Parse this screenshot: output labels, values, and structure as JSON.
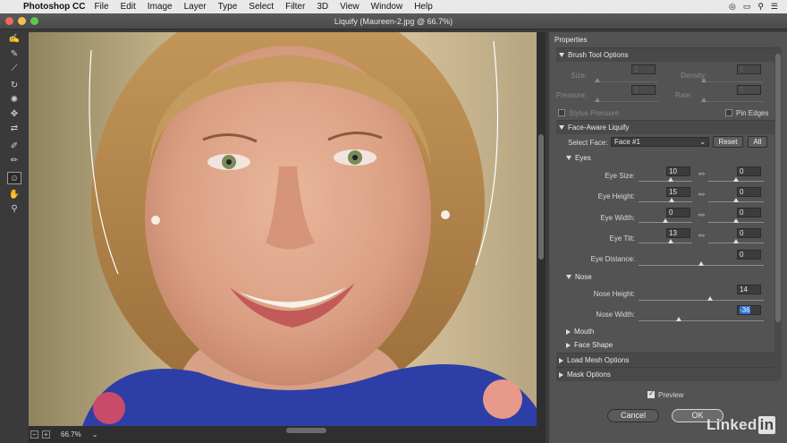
{
  "menubar": {
    "app": "Photoshop CC",
    "items": [
      "File",
      "Edit",
      "Image",
      "Layer",
      "Type",
      "Select",
      "Filter",
      "3D",
      "View",
      "Window",
      "Help"
    ]
  },
  "window": {
    "title": "Liquify (Maureen-2.jpg @ 66.7%)"
  },
  "status": {
    "zoom": "66.7%"
  },
  "panel": {
    "title": "Properties",
    "brush": {
      "header": "Brush Tool Options",
      "size": "Size:",
      "density": "Density:",
      "pressure": "Pressure:",
      "rate": "Rate:",
      "stylus": "Stylus Pressure",
      "pin_edges": "Pin Edges",
      "size_val": "1",
      "density_val": "0",
      "pressure_val": "1",
      "rate_val": "0"
    },
    "face": {
      "header": "Face-Aware Liquify",
      "select_face": "Select Face:",
      "face_value": "Face #1",
      "reset": "Reset",
      "all": "All",
      "eyes": {
        "header": "Eyes",
        "size": "Eye Size:",
        "height": "Eye Height:",
        "width": "Eye Width:",
        "tilt": "Eye Tilt:",
        "distance": "Eye Distance:",
        "size_l": "10",
        "size_r": "0",
        "height_l": "15",
        "height_r": "0",
        "width_l": "0",
        "width_r": "0",
        "tilt_l": "13",
        "tilt_r": "0",
        "distance_val": "0",
        "levels": {
          "size_l": 0.6,
          "size_r": 0.5,
          "height_l": 0.62,
          "height_r": 0.5,
          "width_l": 0.5,
          "width_r": 0.5,
          "tilt_l": 0.6,
          "tilt_r": 0.5,
          "distance": 0.5
        }
      },
      "nose": {
        "header": "Nose",
        "height": "Nose Height:",
        "width": "Nose Width:",
        "height_val": "14",
        "width_val": "-36",
        "height_level": 0.57,
        "width_level": 0.32
      },
      "mouth": "Mouth",
      "face_shape": "Face Shape"
    },
    "load_mesh": "Load Mesh Options",
    "mask": "Mask Options",
    "preview": "Preview",
    "cancel": "Cancel",
    "ok": "OK"
  },
  "watermark": {
    "text": "Linked",
    "in": "in"
  }
}
